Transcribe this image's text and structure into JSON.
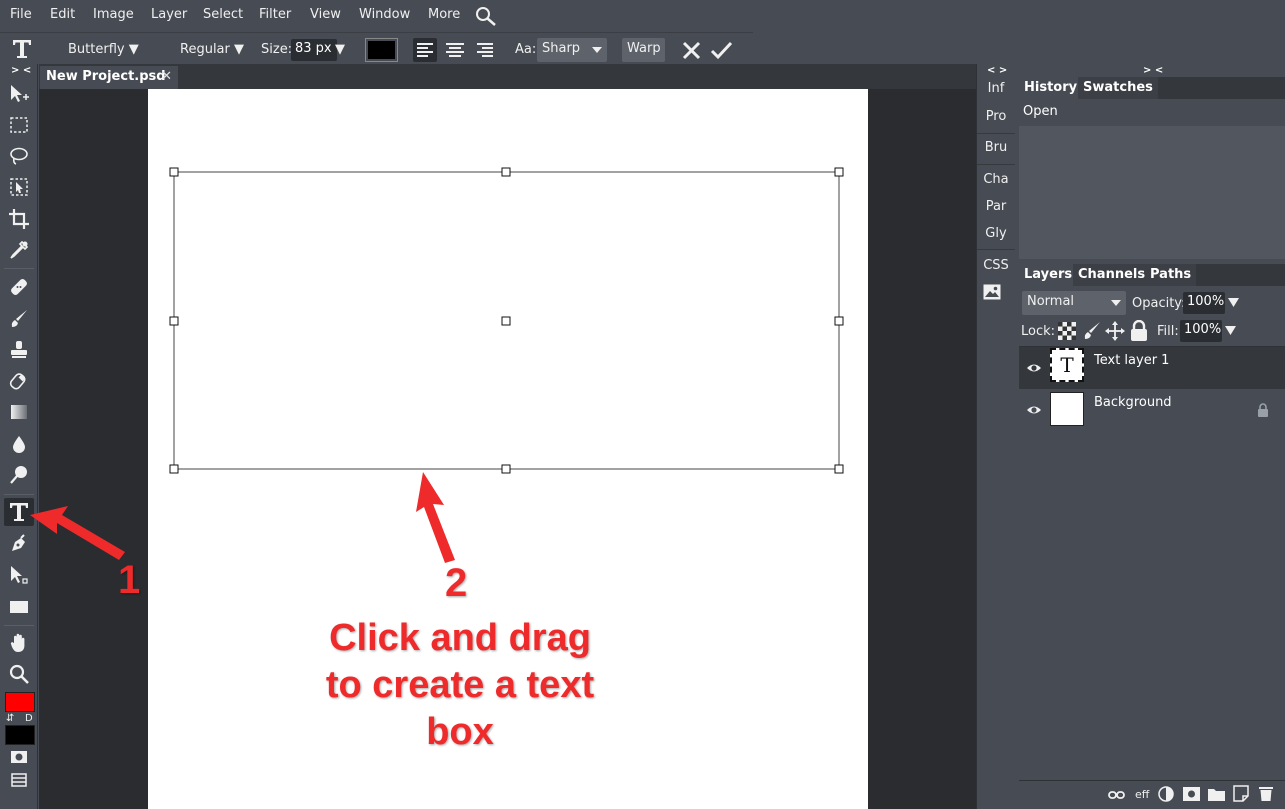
{
  "menu": {
    "items": [
      "File",
      "Edit",
      "Image",
      "Layer",
      "Select",
      "Filter",
      "View",
      "Window",
      "More"
    ]
  },
  "options_bar": {
    "font_family": "Butterfly ▼",
    "font_style": "Regular ▼",
    "size_label": "Size:",
    "size_value": "83 px",
    "size_arrow": "▼",
    "text_color": "#000000",
    "aa_label": "Aa:",
    "aa_value": "Sharp",
    "warp_label": "Warp"
  },
  "document": {
    "tab_title": "New Project.psd",
    "tab_close": "✕"
  },
  "collapse": {
    "left": "> <",
    "mid": "< >",
    "right": "> <"
  },
  "mid_panel": {
    "buttons": [
      "Inf",
      "Pro",
      "Bru",
      "Cha",
      "Par",
      "Gly",
      "CSS"
    ]
  },
  "history_panel": {
    "tabs": [
      "History",
      "Swatches"
    ],
    "items": [
      "Open"
    ]
  },
  "layers_panel": {
    "tabs": [
      "Layers",
      "Channels",
      "Paths"
    ],
    "blend_mode": "Normal",
    "opacity_label": "Opacity:",
    "opacity_value": "100%",
    "lock_label": "Lock:",
    "fill_label": "Fill:",
    "fill_value": "100%",
    "layers": [
      {
        "name": "Text layer 1",
        "thumb": "T"
      },
      {
        "name": "Background"
      }
    ],
    "footer_eff": "eff"
  },
  "toolbar": {
    "swap_label": "⇵",
    "default_label": "D",
    "foreground": "#ff0000",
    "background": "#000000"
  },
  "annotation": {
    "num1": "1",
    "num2": "2",
    "line1": "Click and drag",
    "line2": "to create a text",
    "line3": "box",
    "color": "#ef2a2a"
  }
}
